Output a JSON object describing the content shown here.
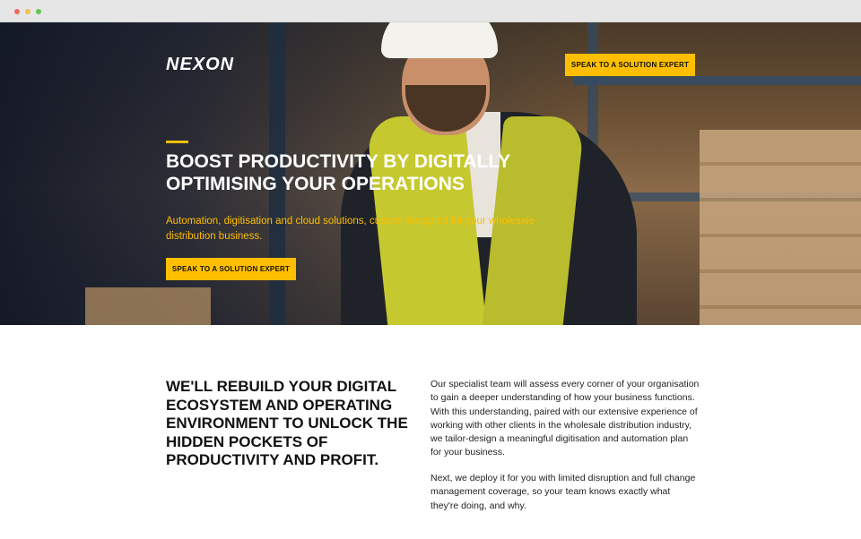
{
  "header": {
    "logo_text": "NEXON",
    "cta_label": "SPEAK TO A SOLUTION EXPERT"
  },
  "hero": {
    "title": "BOOST PRODUCTIVITY BY DIGITALLY OPTIMISING YOUR OPERATIONS",
    "subtitle": "Automation, digitisation and cloud solutions, custom-designed for your wholesale distribution business.",
    "cta_label": "SPEAK TO A SOLUTION EXPERT"
  },
  "content": {
    "heading": "WE'LL REBUILD YOUR DIGITAL ECOSYSTEM AND OPERATING ENVIRONMENT TO UNLOCK THE HIDDEN POCKETS OF PRODUCTIVITY AND PROFIT.",
    "paragraphs": [
      "Our specialist team will assess every corner of your organisation to gain a deeper understanding of how your business functions. With this understanding, paired with our extensive experience of working with other clients in the wholesale distribution industry, we tailor-design a meaningful digitisation and automation plan for your business.",
      "Next, we deploy it for you with limited disruption and full change management coverage, so your team knows exactly what they're doing, and why."
    ]
  },
  "colors": {
    "accent": "#ffbf00",
    "hero_overlay": "#0f1626",
    "text": "#111111"
  },
  "icons": {
    "window_controls": [
      "close-dot",
      "minimize-dot",
      "maximize-dot"
    ]
  }
}
